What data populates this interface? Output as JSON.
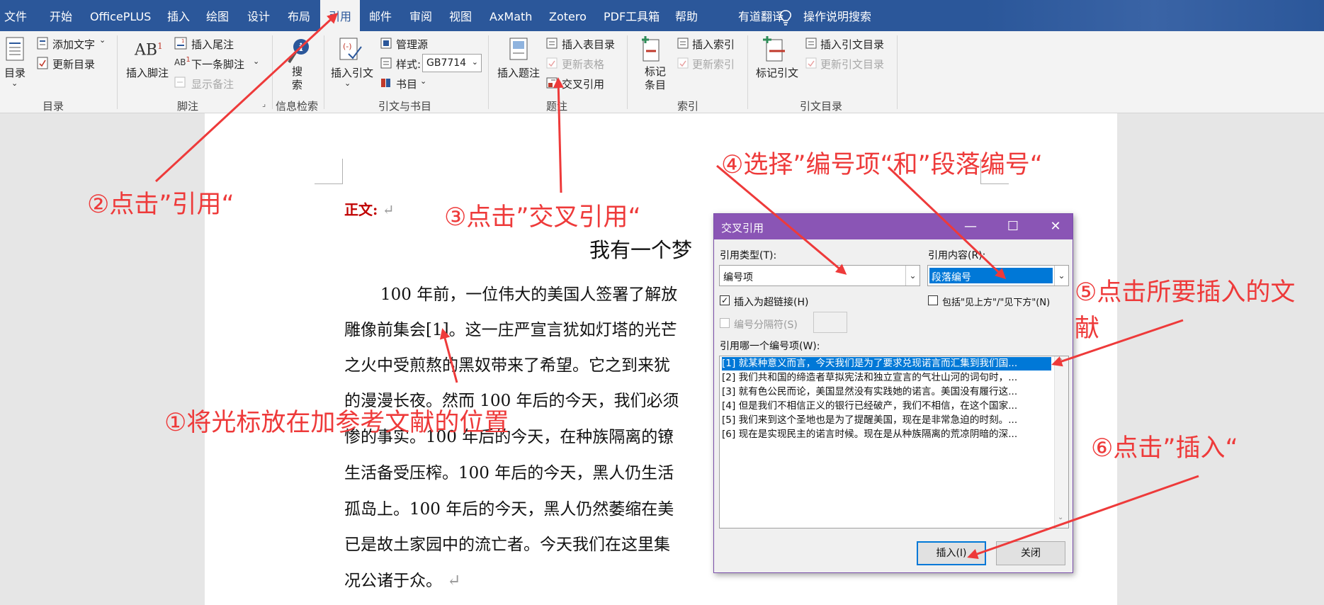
{
  "menu": {
    "tabs": [
      "文件",
      "开始",
      "OfficePLUS",
      "插入",
      "绘图",
      "设计",
      "布局",
      "引用",
      "邮件",
      "审阅",
      "视图",
      "AxMath",
      "Zotero",
      "PDF工具箱",
      "帮助",
      "有道翻译"
    ],
    "active_tab": "引用",
    "tell_me": "操作说明搜索"
  },
  "ribbon": {
    "toc": {
      "toc_label": "目录",
      "add_text": "添加文字",
      "update_toc": "更新目录",
      "group": "目录"
    },
    "footnotes": {
      "insert_footnote": "插入脚注",
      "insert_endnote": "插入尾注",
      "next_footnote": "下一条脚注",
      "show_notes": "显示备注",
      "group": "脚注"
    },
    "research": {
      "search": "搜索",
      "group": "信息检索"
    },
    "citations": {
      "insert_citation": "插入引文",
      "manage_sources": "管理源",
      "style_label": "样式:",
      "style_value": "GB7714",
      "bibliography": "书目",
      "group": "引文与书目"
    },
    "captions": {
      "insert_caption": "插入题注",
      "insert_table_of_figures": "插入表目录",
      "update_table": "更新表格",
      "cross_reference": "交叉引用",
      "group": "题注"
    },
    "index": {
      "mark_entry": "标记条目",
      "insert_index": "插入索引",
      "update_index": "更新索引",
      "group": "索引"
    },
    "authorities": {
      "mark_citation": "标记引文",
      "insert_toa": "插入引文目录",
      "update_toa": "更新引文目录",
      "group": "引文目录"
    }
  },
  "document": {
    "section_label": "正文:",
    "title": "我有一个梦",
    "lines": [
      "100 年前，一位伟大的美国人签署了解放",
      "雕像前集会[1]。这一庄严宣言犹如灯塔的光芒",
      "之火中受煎熬的黑奴带来了希望。它之到来犹",
      "的漫漫长夜。然而 100 年后的今天，我们必须",
      "惨的事实。100 年后的今天，在种族隔离的镣",
      "生活备受压榨。100 年后的今天，黑人仍生活",
      "孤岛上。100 年后的今天，黑人仍然萎缩在美",
      "已是故土家园中的流亡者。今天我们在这里集",
      "况公诸于众。"
    ]
  },
  "dialog": {
    "title": "交叉引用",
    "ref_type_label": "引用类型(T):",
    "ref_type_value": "编号项",
    "ref_content_label": "引用内容(R):",
    "ref_content_value": "段落编号",
    "insert_hyperlink": "插入为超链接(H)",
    "include_above_below": "包括\"见上方\"/\"见下方\"(N)",
    "separate_numbers": "编号分隔符(S)",
    "which_item_label": "引用哪一个编号项(W):",
    "items": [
      "[1] 就某种意义而言，今天我们是为了要求兑现诺言而汇集到我们国...",
      "[2] 我们共和国的缔造者草拟宪法和独立宣言的气壮山河的词句时，...",
      "[3] 就有色公民而论，美国显然没有实践她的诺言。美国没有履行这...",
      "[4] 但是我们不相信正义的银行已经破产，我们不相信，在这个国家...",
      "[5] 我们来到这个圣地也是为了提醒美国，现在是非常急迫的时刻。...",
      "[6] 现在是实现民主的诺言时候。现在是从种族隔离的荒凉阴暗的深..."
    ],
    "selected_index": 0,
    "insert_button": "插入(I)",
    "close_button": "关闭",
    "hyperlink_checked": true,
    "above_below_checked": false
  },
  "annotations": {
    "step1": "①将光标放在加参考文献的位置",
    "step2": "②点击”引用“",
    "step3": "③点击”交叉引用“",
    "step4": "④选择”编号项“和”段落编号“",
    "step5_line1": "⑤点击所要插入的文",
    "step5_line2": "献",
    "step6": "⑥点击”插入“"
  },
  "colors": {
    "ribbon_blue": "#2b579a",
    "dialog_purple": "#8a55b5",
    "annotation_red": "#ee3a3a",
    "selection_blue": "#0078d7"
  }
}
